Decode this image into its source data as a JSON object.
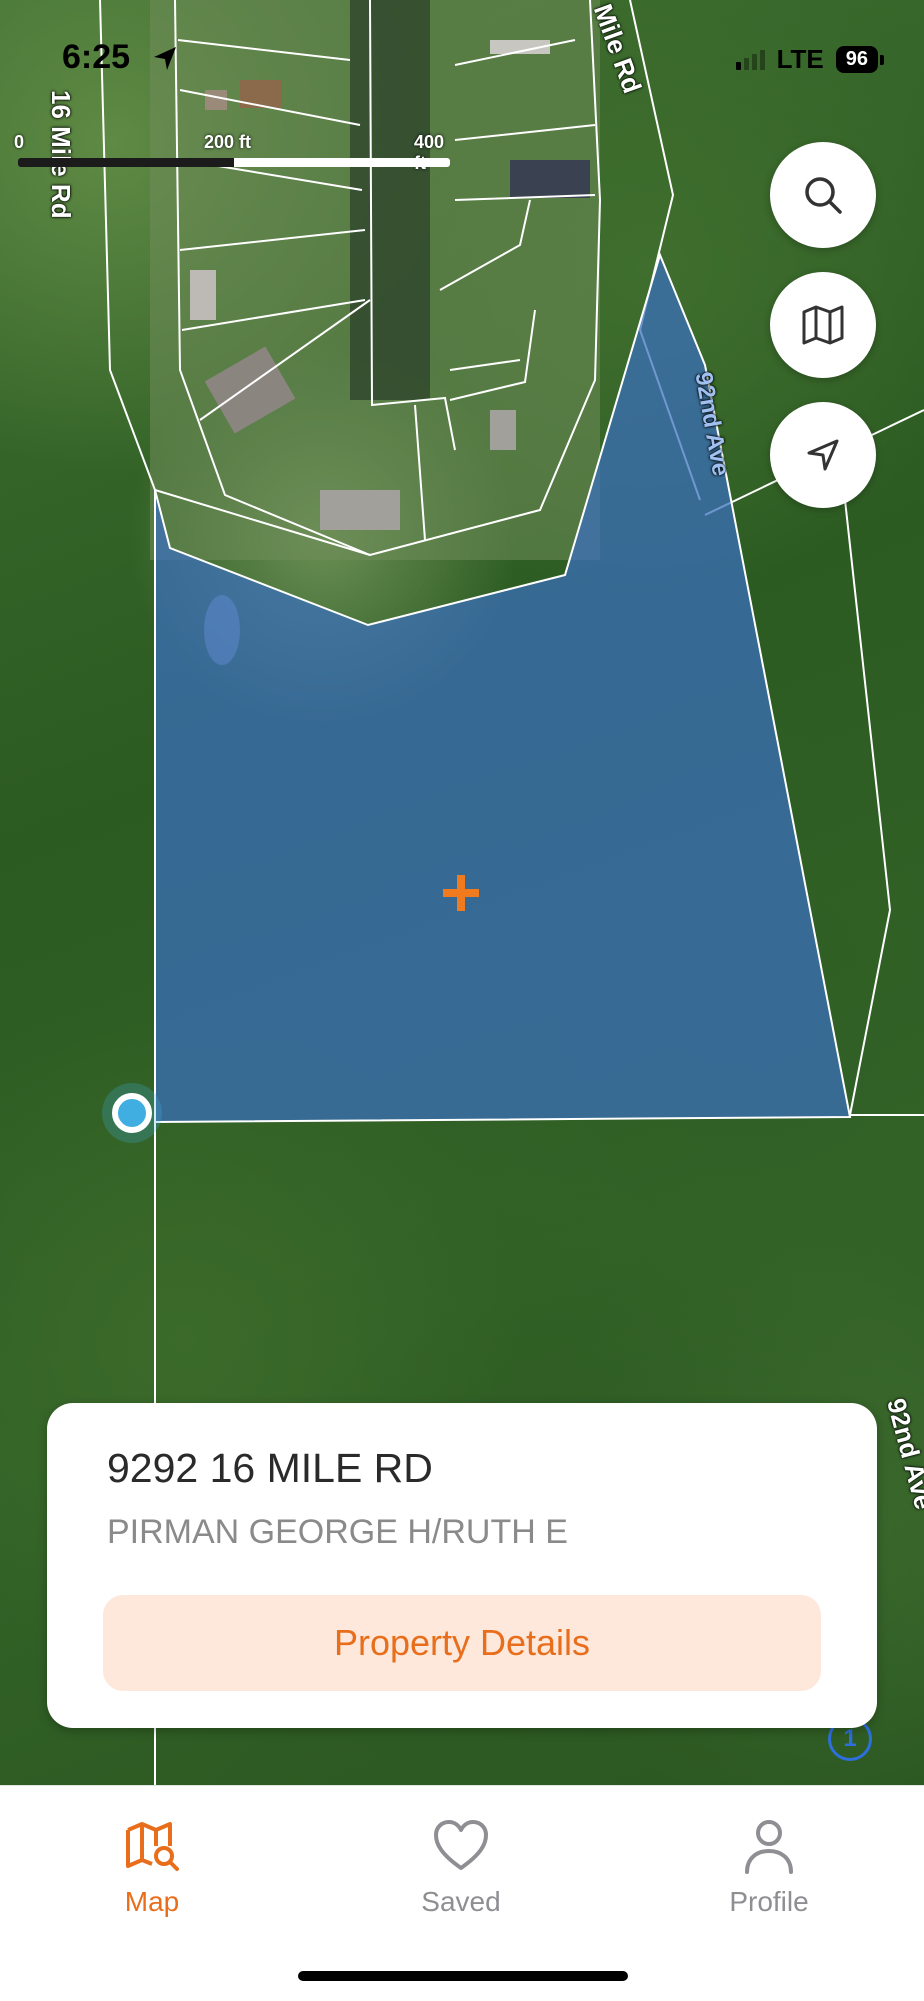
{
  "status_bar": {
    "time": "6:25",
    "network": "LTE",
    "battery": "96"
  },
  "map": {
    "scale": {
      "tick_0": "0",
      "tick_1": "200 ft",
      "tick_2": "400 ft"
    },
    "road_labels": {
      "road_a": "16 Mile Rd",
      "road_b": "Mile Rd",
      "road_c": "92nd Ave",
      "road_d": "92nd Ave"
    },
    "parcel_color": "#3a6fbf",
    "marker_color": "#f07a1e",
    "user_location_color": "#40aee0",
    "cluster_badge": "1"
  },
  "controls": {
    "search_icon": "search-icon",
    "layers_icon": "map-icon",
    "locate_icon": "location-arrow-icon"
  },
  "property_card": {
    "address": "9292 16 MILE RD",
    "owner": "PIRMAN GEORGE H/RUTH E",
    "details_button": "Property Details",
    "accent": "#e96e1c"
  },
  "tab_bar": {
    "tabs": [
      {
        "label": "Map",
        "icon": "map-search-icon",
        "active": true
      },
      {
        "label": "Saved",
        "icon": "heart-icon",
        "active": false
      },
      {
        "label": "Profile",
        "icon": "person-icon",
        "active": false
      }
    ]
  }
}
